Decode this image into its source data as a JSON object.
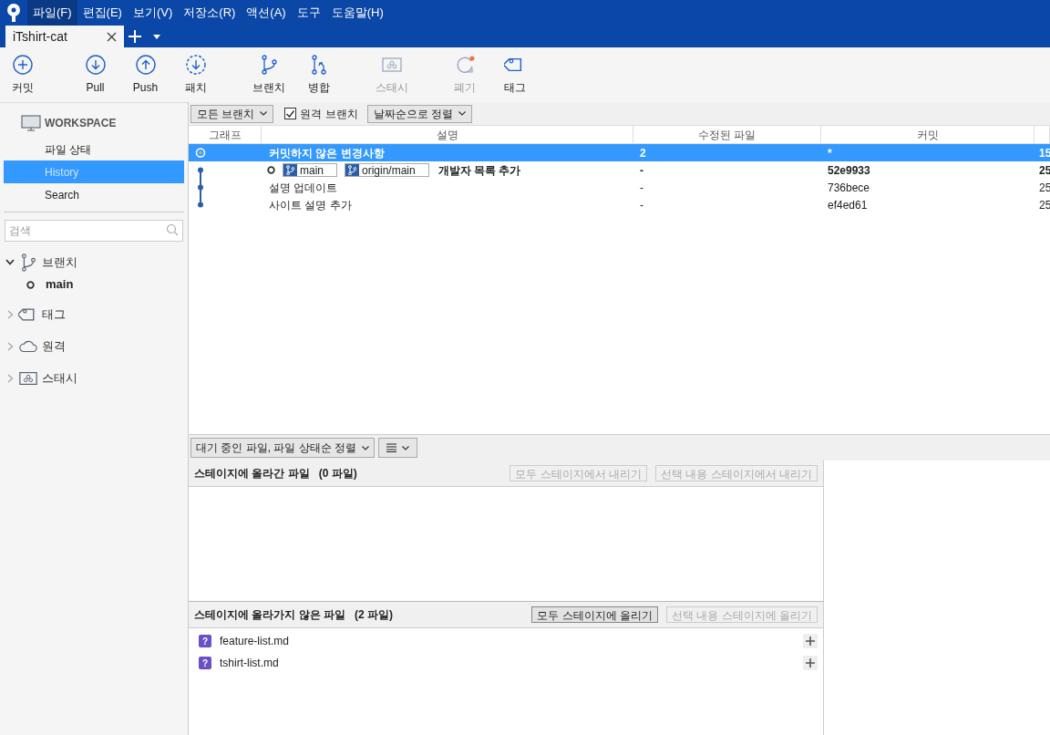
{
  "menu": [
    {
      "label": "파일(F)",
      "selected": true
    },
    {
      "label": "편집(E)",
      "selected": false
    },
    {
      "label": "보기(V)",
      "selected": false
    },
    {
      "label": "저장소(R)",
      "selected": false
    },
    {
      "label": "액션(A)",
      "selected": false
    },
    {
      "label": "도구",
      "selected": false
    },
    {
      "label": "도움말(H)",
      "selected": false
    }
  ],
  "tabs": [
    {
      "label": "iTshirt-cat",
      "selected": true
    }
  ],
  "toolbar": {
    "groups": [
      [
        {
          "label": "커밋",
          "kind": "commit",
          "disabled": false
        }
      ],
      [
        {
          "label": "Pull",
          "kind": "pull",
          "disabled": false
        },
        {
          "label": "Push",
          "kind": "push",
          "disabled": false
        },
        {
          "label": "패치",
          "kind": "fetch",
          "disabled": false
        }
      ],
      [
        {
          "label": "브랜치",
          "kind": "branch",
          "disabled": false
        },
        {
          "label": "병합",
          "kind": "merge",
          "disabled": false
        }
      ],
      [
        {
          "label": "스태시",
          "kind": "stash",
          "disabled": true
        }
      ],
      [
        {
          "label": "폐기",
          "kind": "discard",
          "disabled": true
        },
        {
          "label": "태그",
          "kind": "tag",
          "disabled": false
        }
      ]
    ]
  },
  "sidebar": {
    "workspace": {
      "title": "WORKSPACE",
      "items": [
        {
          "label": "파일 상태",
          "selected": false
        },
        {
          "label": "History",
          "selected": true
        },
        {
          "label": "Search",
          "selected": false
        }
      ]
    },
    "search": {
      "placeholder": "검색"
    },
    "tree": [
      {
        "label": "브랜치",
        "kind": "branch",
        "expanded": true,
        "children": [
          {
            "label": "main",
            "current": true
          }
        ]
      },
      {
        "label": "태그",
        "kind": "tag",
        "expanded": false
      },
      {
        "label": "원격",
        "kind": "cloud",
        "expanded": false
      },
      {
        "label": "스태시",
        "kind": "stash",
        "expanded": false
      }
    ]
  },
  "filters": {
    "branches": "모든 브랜치",
    "remote_branches": {
      "label": "원격 브랜치",
      "checked": true
    },
    "sort": "날짜순으로 정렬"
  },
  "table": {
    "columns": [
      "그래프",
      "설명",
      "수정된 파일",
      "커밋"
    ],
    "rows": [
      {
        "kind": "uncommitted",
        "selected": true,
        "current": false,
        "refs": [],
        "description": "커밋하지 않은 변경사항",
        "files": "2",
        "commit": "*",
        "column_5": "15"
      },
      {
        "kind": "commit",
        "selected": false,
        "current": true,
        "refs": [
          {
            "label": "main"
          },
          {
            "label": "origin/main"
          }
        ],
        "description": "개발자 목록 추가",
        "files": "-",
        "commit": "52e9933",
        "column_5": "25"
      },
      {
        "kind": "commit",
        "selected": false,
        "current": false,
        "refs": [],
        "description": "설명 업데이트",
        "files": "-",
        "commit": "736bece",
        "column_5": "25"
      },
      {
        "kind": "commit",
        "selected": false,
        "current": false,
        "refs": [],
        "description": "사이트 설명 추가",
        "files": "-",
        "commit": "ef4ed61",
        "column_5": "25"
      }
    ]
  },
  "files_toolbar": {
    "sort": "대기 중인 파일, 파일 상태순 정렬"
  },
  "staged": {
    "title": "스테이지에 올라간 파일",
    "count": "(0 파일)",
    "buttons": [
      {
        "label": "모두 스테이지에서 내리기",
        "disabled": true
      },
      {
        "label": "선택 내용 스테이지에서 내리기",
        "disabled": true
      }
    ]
  },
  "unstaged": {
    "title": "스테이지에 올라가지 않은 파일",
    "count": "(2 파일)",
    "buttons": [
      {
        "label": "모두 스테이지에 올리기",
        "disabled": false
      },
      {
        "label": "선택 내용 스테이지에 올리기",
        "disabled": true
      }
    ],
    "files": [
      {
        "name": "feature-list.md",
        "status": "?"
      },
      {
        "name": "tshirt-list.md",
        "status": "?"
      }
    ]
  }
}
